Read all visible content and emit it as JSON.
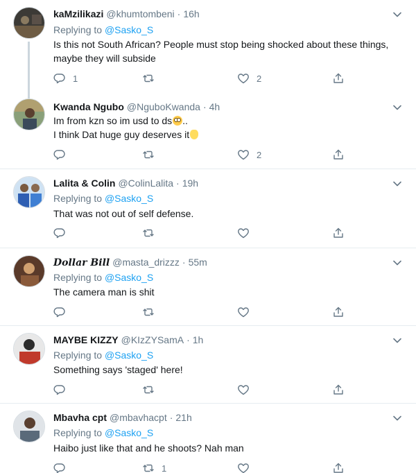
{
  "tweets": [
    {
      "name": "kaMzilikazi",
      "handle": "@khumtombeni",
      "separator": "·",
      "time": "16h",
      "replying_label": "Replying to",
      "replying_to": "@Sasko_S",
      "text_lines": [
        "Is this not South African? People must stop being shocked about these things,",
        "maybe they will subside"
      ],
      "reply_count": "1",
      "retweet_count": "",
      "like_count": "2",
      "avatar_colors": [
        "#3c3a36",
        "#8a7a60"
      ]
    },
    {
      "name": "Kwanda Ngubo",
      "handle": "@NguboKwanda",
      "separator": "·",
      "time": "4h",
      "text_lines": [
        "Im from kzn so im usd to ds",
        "I think Dat huge guy deserves it"
      ],
      "line1_suffix": "..",
      "reply_count": "",
      "retweet_count": "",
      "like_count": "2",
      "avatar_colors": [
        "#6a7a5a",
        "#b0a070"
      ]
    },
    {
      "name": "Lalita & Colin",
      "handle": "@ColinLalita",
      "separator": "·",
      "time": "19h",
      "replying_label": "Replying to",
      "replying_to": "@Sasko_S",
      "text_lines": [
        "That was not out of self defense."
      ],
      "reply_count": "",
      "retweet_count": "",
      "like_count": "",
      "avatar_colors": [
        "#2f5fb3",
        "#7fb0e0"
      ]
    },
    {
      "name": "Dollar Bill",
      "handle": "@masta_drizzz",
      "separator": "·",
      "time": "55m",
      "replying_label": "Replying to",
      "replying_to": "@Sasko_S",
      "text_lines": [
        "The camera man is shit"
      ],
      "reply_count": "",
      "retweet_count": "",
      "like_count": "",
      "avatar_colors": [
        "#8a5a3a",
        "#d0a070"
      ]
    },
    {
      "name": "MAYBE KIZZY",
      "handle": "@KIzZYSamA",
      "separator": "·",
      "time": "1h",
      "replying_label": "Replying to",
      "replying_to": "@Sasko_S",
      "text_lines": [
        "Something says 'staged' here!"
      ],
      "reply_count": "",
      "retweet_count": "",
      "like_count": "",
      "avatar_colors": [
        "#c0392b",
        "#2c2c2c"
      ]
    },
    {
      "name": "Mbavha cpt",
      "handle": "@mbavhacpt",
      "separator": "·",
      "time": "21h",
      "replying_label": "Replying to",
      "replying_to": "@Sasko_S",
      "text_lines": [
        "Haibo just like that and he shoots? Nah man"
      ],
      "reply_count": "",
      "retweet_count": "1",
      "like_count": "",
      "avatar_colors": [
        "#5a6a7a",
        "#e0e4e8"
      ]
    }
  ],
  "colors": {
    "link": "#1da1f2",
    "secondary_text": "#657786",
    "divider": "#e6ecf0",
    "thread_line": "#ccd6dd"
  },
  "icons": [
    "reply-icon",
    "retweet-icon",
    "like-icon",
    "share-icon",
    "caret-down-icon"
  ]
}
